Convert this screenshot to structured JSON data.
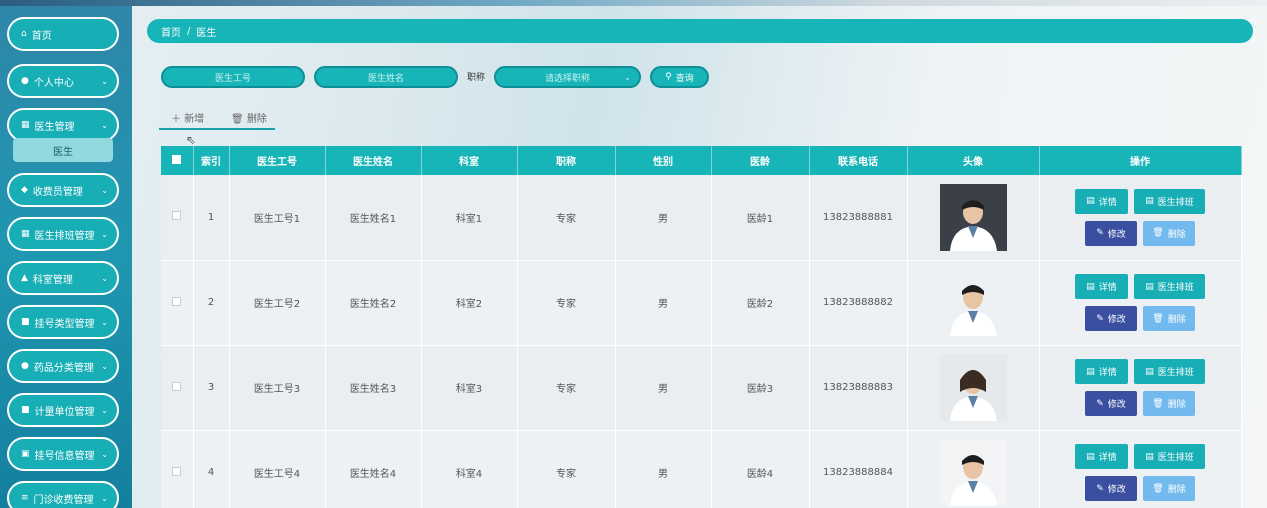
{
  "sidebar": {
    "items": [
      {
        "label": "首页",
        "icon": "home-icon",
        "glyph": "⌂",
        "chev": ""
      },
      {
        "label": "个人中心",
        "icon": "user-icon",
        "glyph": "●",
        "chev": "⌄"
      },
      {
        "label": "医生管理",
        "icon": "grid-icon",
        "glyph": "▦",
        "chev": "⌄"
      },
      {
        "label": "收费员管理",
        "icon": "thumb-icon",
        "glyph": "◆",
        "chev": "⌄"
      },
      {
        "label": "医生排班管理",
        "icon": "grid-icon",
        "glyph": "▦",
        "chev": "⌄"
      },
      {
        "label": "科室管理",
        "icon": "building-icon",
        "glyph": "▲",
        "chev": "⌄"
      },
      {
        "label": "挂号类型管理",
        "icon": "clipboard-icon",
        "glyph": "■",
        "chev": "⌄"
      },
      {
        "label": "药品分类管理",
        "icon": "pin-icon",
        "glyph": "●",
        "chev": "⌄"
      },
      {
        "label": "计量单位管理",
        "icon": "clipboard-icon",
        "glyph": "■",
        "chev": "⌄"
      },
      {
        "label": "挂号信息管理",
        "icon": "document-icon",
        "glyph": "▣",
        "chev": "⌄"
      },
      {
        "label": "门诊收费管理",
        "icon": "menu-icon",
        "glyph": "≡",
        "chev": "⌄"
      }
    ],
    "submenu_label": "医生"
  },
  "breadcrumb": {
    "home": "首页",
    "separator": "/",
    "current": "医生"
  },
  "search": {
    "doctor_id_placeholder": "医生工号",
    "doctor_name_placeholder": "医生姓名",
    "title_label": "职称",
    "title_select_placeholder": "请选择职称",
    "query_label": "查询"
  },
  "actions": {
    "add_label": "新增",
    "delete_label": "删除"
  },
  "table": {
    "headers": [
      "索引",
      "医生工号",
      "医生姓名",
      "科室",
      "职称",
      "性别",
      "医龄",
      "联系电话",
      "头像",
      "操作"
    ],
    "rows": [
      {
        "index": "1",
        "doctor_id": "医生工号1",
        "name": "医生姓名1",
        "dept": "科室1",
        "title": "专家",
        "gender": "男",
        "seniority": "医龄1",
        "phone": "13823888881"
      },
      {
        "index": "2",
        "doctor_id": "医生工号2",
        "name": "医生姓名2",
        "dept": "科室2",
        "title": "专家",
        "gender": "男",
        "seniority": "医龄2",
        "phone": "13823888882"
      },
      {
        "index": "3",
        "doctor_id": "医生工号3",
        "name": "医生姓名3",
        "dept": "科室3",
        "title": "专家",
        "gender": "男",
        "seniority": "医龄3",
        "phone": "13823888883"
      },
      {
        "index": "4",
        "doctor_id": "医生工号4",
        "name": "医生姓名4",
        "dept": "科室4",
        "title": "专家",
        "gender": "男",
        "seniority": "医龄4",
        "phone": "13823888884"
      }
    ],
    "op_labels": {
      "detail": "详情",
      "schedule": "医生排班",
      "edit": "修改",
      "delete": "删除"
    }
  },
  "colors": {
    "accent": "#17b5b8",
    "sidebar": "#1f97b1",
    "edit_button": "#3a4fa0",
    "delete_button": "#72b9ee"
  }
}
